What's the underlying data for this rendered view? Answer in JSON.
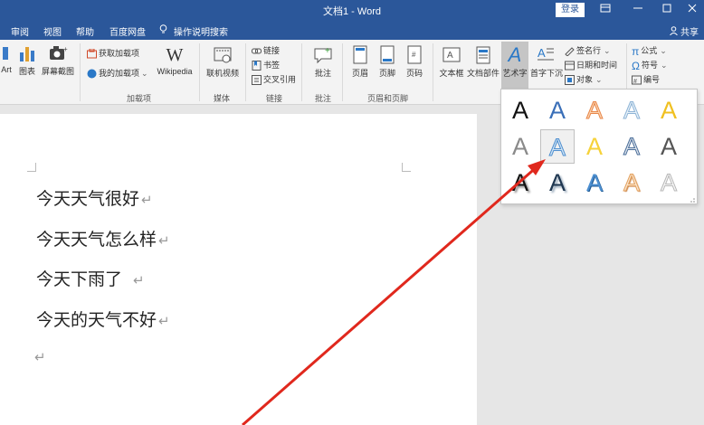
{
  "window": {
    "title": "文档1  -  Word",
    "login_label": "登录",
    "colors": {
      "titlebar": "#2b579a",
      "arrow": "#e0281d"
    }
  },
  "tabs": [
    "审阅",
    "视图",
    "帮助",
    "百度网盘",
    "操作说明搜索"
  ],
  "share_label": "共享",
  "ribbon": {
    "left_buttons": [
      "Art",
      "图表",
      "屏幕截图"
    ],
    "addins": {
      "get": "获取加载项",
      "mine": "我的加载项",
      "wiki": "Wikipedia",
      "group": "加载项"
    },
    "media": {
      "video": "联机视频",
      "group": "媒体"
    },
    "links": {
      "link": "链接",
      "bookmark": "书签",
      "crossref": "交叉引用",
      "group": "链接"
    },
    "comments": {
      "comment": "批注",
      "group": "批注"
    },
    "header_footer": {
      "header": "页眉",
      "footer": "页脚",
      "page_number": "页码",
      "group": "页眉和页脚"
    },
    "text": {
      "textbox": "文本框",
      "quickparts": "文档部件",
      "wordart": "艺术字",
      "dropcap": "首字下沉",
      "signature": "签名行",
      "datetime": "日期和时间",
      "object": "对象"
    },
    "symbols": {
      "equation": "公式",
      "symbol": "符号",
      "number": "编号"
    }
  },
  "document": {
    "lines": [
      "今天天气很好",
      "今天天气怎么样",
      "今天下雨了",
      "今天的天气不好"
    ],
    "para_mark": "↵"
  },
  "wordart_gallery": {
    "glyph": "A",
    "styles": [
      [
        "black-fill",
        "blue-fill",
        "orange-outline",
        "lightblue-outline",
        "gold-fill"
      ],
      [
        "gray-fill",
        "blue-outline-selected",
        "yellow-fill",
        "blue-gradient-outline",
        "darkgray-fill"
      ],
      [
        "black-shadow",
        "navy-shadow",
        "blue-bevel",
        "orange-bevel",
        "white-gray"
      ]
    ]
  }
}
